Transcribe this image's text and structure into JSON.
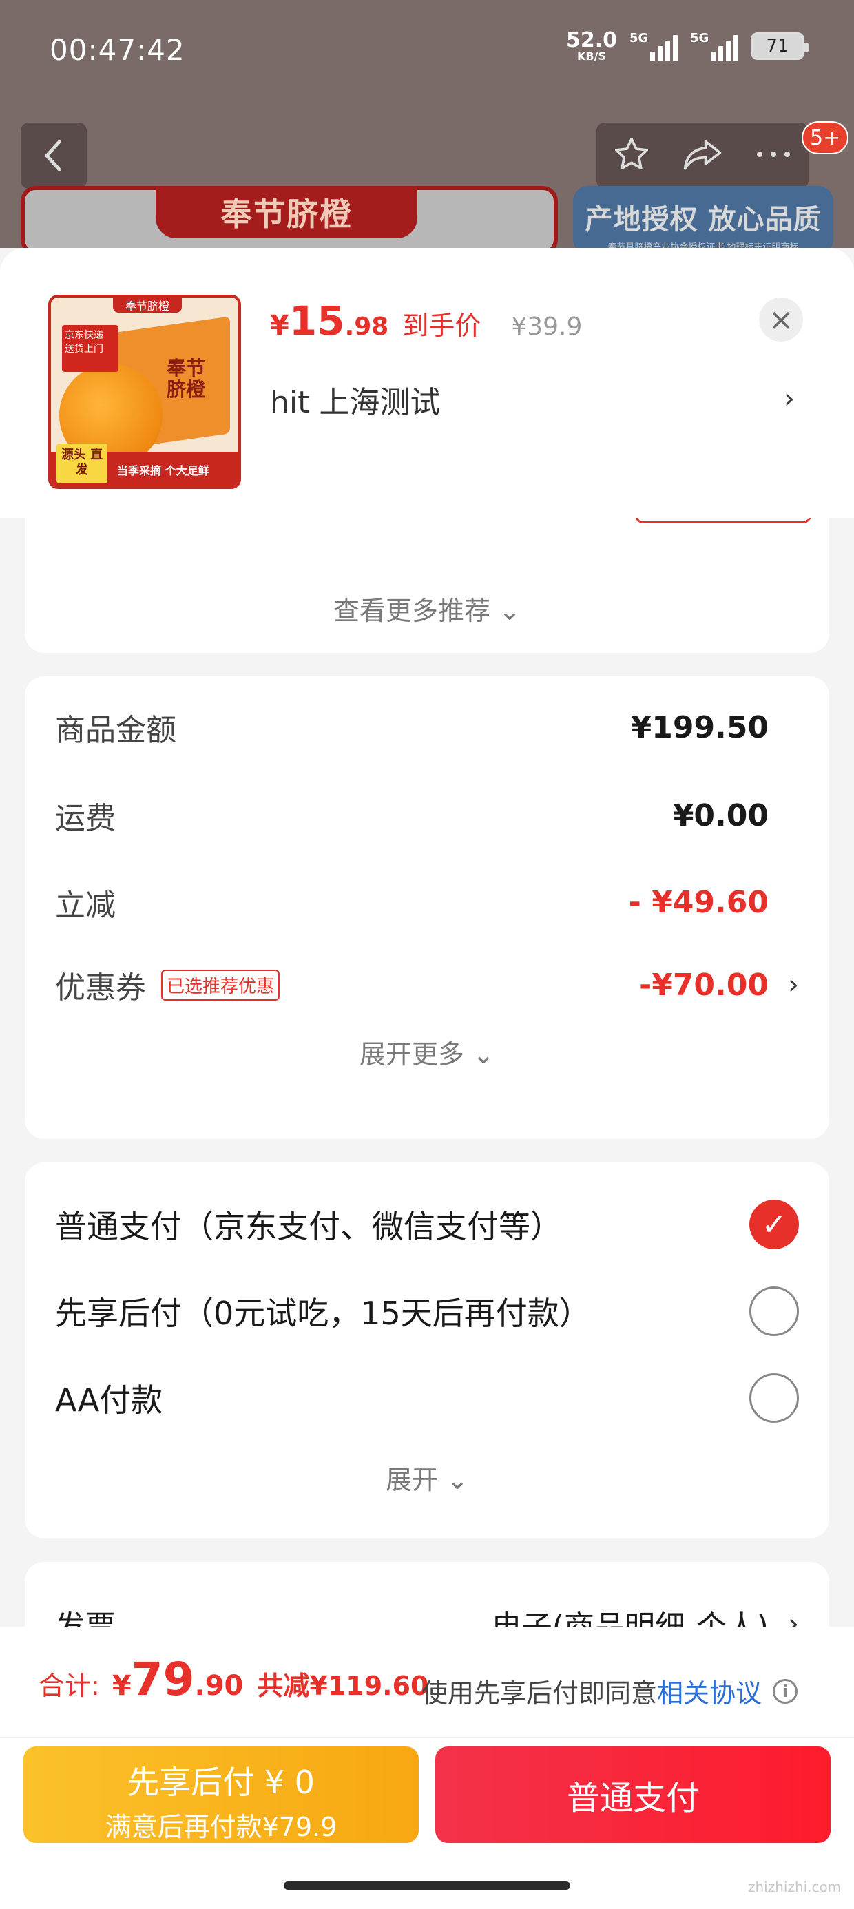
{
  "status_bar": {
    "time": "00:47:42",
    "net_speed": "52.0",
    "net_unit": "KB/S",
    "signal1_tag": "5G",
    "signal2_tag": "5G",
    "battery": "71"
  },
  "background": {
    "banner_left_title": "奉节脐橙",
    "banner_right_title": "产地授权 放心品质",
    "banner_right_sub": "奉节县脐橙产业协会授权证书,地理标志证明商标",
    "cart_badge": "5+"
  },
  "product": {
    "image_top_label": "奉节脐橙",
    "image_sticker": "京东快递 送货上门",
    "image_box_text": "奉节 脐橙",
    "image_source": "源头 直发",
    "image_slogan": "当季采摘 个大足鲜",
    "price_symbol": "¥",
    "price_int": "15",
    "price_dec": ".98",
    "price_tag": "到手价",
    "original_price": "¥39.9",
    "address": "hit  上海测试",
    "close": "×"
  },
  "recommend": {
    "more_label": "查看更多推荐"
  },
  "summary": {
    "rows": [
      {
        "label": "商品金额",
        "value": "¥199.50"
      },
      {
        "label": "运费",
        "value": "¥0.00"
      },
      {
        "label": "立减",
        "value": "- ¥49.60"
      },
      {
        "label": "优惠券",
        "value": "-¥70.00",
        "tag": "已选推荐优惠"
      }
    ],
    "expand_label": "展开更多"
  },
  "payment": {
    "options": [
      {
        "label": "普通支付（京东支付、微信支付等）",
        "selected": true
      },
      {
        "label": "先享后付（0元试吃，15天后再付款）",
        "selected": false
      },
      {
        "label": "AA付款",
        "selected": false
      }
    ],
    "expand_label": "展开"
  },
  "invoice": {
    "label": "发票",
    "value": "电子(商品明细-个人)"
  },
  "footer": {
    "total_label": "合计:",
    "total_symbol": "¥",
    "total_int": "79",
    "total_dec": ".90",
    "total_discount": "共减¥119.60",
    "agree_text": "使用先享后付即同意",
    "agree_link": "相关协议",
    "btn_later_line1": "先享后付 ¥ 0",
    "btn_later_line2": "满意后再付款¥79.9",
    "btn_pay": "普通支付"
  },
  "watermark": "zhizhizhi.com",
  "colors": {
    "accent_red": "#e8302a",
    "link_blue": "#2a6fd6",
    "pay_later_yellow": "#fbc22a",
    "pay_red": "#fe1b2c"
  }
}
